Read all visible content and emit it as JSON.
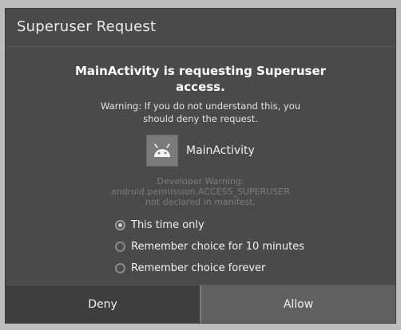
{
  "dialog": {
    "title": "Superuser Request",
    "headline_line1": "MainActivity is requesting Superuser",
    "headline_line2": "access.",
    "warning_line1": "Warning: If you do not understand this, you",
    "warning_line2": "should deny the request.",
    "app_name": "MainActivity",
    "app_icon": "android-icon",
    "dev_warning_line1": "Developer Warning:",
    "dev_warning_line2": "android.permission.ACCESS_SUPERUSER",
    "dev_warning_line3": "not declared in manifest.",
    "options": [
      {
        "label": "This time only",
        "selected": true
      },
      {
        "label": "Remember choice for 10 minutes",
        "selected": false
      },
      {
        "label": "Remember choice forever",
        "selected": false
      }
    ],
    "deny_label": "Deny",
    "allow_label": "Allow"
  }
}
